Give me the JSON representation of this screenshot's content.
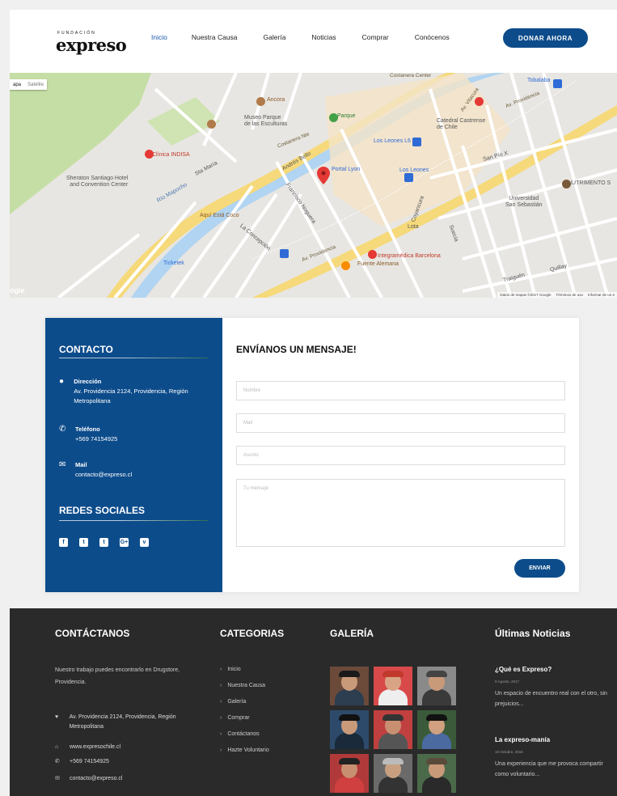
{
  "header": {
    "logo_small": "FUNDACIÓN",
    "logo_big": "expreso",
    "nav": [
      "Inicio",
      "Nuestra Causa",
      "Galería",
      "Noticias",
      "Comprar",
      "Conócenos"
    ],
    "donate_label": "DONAR AHORA"
  },
  "map": {
    "toggle": [
      "apa",
      "Satélite"
    ],
    "google": "ogle",
    "footer": [
      "Datos de mapas ©2017 Google",
      "Términos de uso",
      "Informar de un e"
    ],
    "labels": {
      "costanera_center": "Costanera Center",
      "tobalaba": "Tobalaba",
      "ancora": "Ancora",
      "parque": "Parque",
      "museo": "Museo Parque\nde las Esculturas",
      "catedral": "Catedral Castrense\nde Chile",
      "los_leones_l6": "Los Leones L6",
      "clinica": "Clínica INDISA",
      "portal_lyon": "Portal Lyon",
      "los_leones": "Los Leones",
      "sheraton": "Sheraton Santiago Hotel\nand Convention Center",
      "nutrimento": "NUTRIMENTO S",
      "universidad": "Universidad\nSan Sebastián",
      "aqui_esta_coco": "Aquí Está Coco",
      "ticketek": "Ticketek",
      "integramedica": "Integramédica Barcelona",
      "fuente_alemana": "Fuente Alemana",
      "av_providencia": "Av. Providencia",
      "costanera_nte": "Costanera Nte",
      "rio_mapocho": "Río Mapocho",
      "sta_maria": "Sta María",
      "andres_bello": "Andrés Bello",
      "av_vitacura": "Av. Vitacura",
      "san_pio_x": "San Pío X",
      "coyancura": "Coyancura",
      "lota": "Lota",
      "suecia": "Suecia",
      "traiguen": "Traiguén",
      "quillay": "Quillay",
      "la_concepcion": "La Concepción",
      "francisco_noguera": "Francisco Noguera"
    }
  },
  "contact": {
    "title": "CONTACTO",
    "items": [
      {
        "icon": "location-pin-icon",
        "label": "Dirección",
        "value": "Av. Providencia 2124, Providencia, Región Metropolitana"
      },
      {
        "icon": "phone-icon",
        "label": "Teléfono",
        "value": "+569 74154925"
      },
      {
        "icon": "mail-icon",
        "label": "Mail",
        "value": "contacto@expreso.cl"
      }
    ],
    "social_title": "REDES SOCIALES",
    "social": [
      "f",
      "t",
      "t",
      "G+",
      "v"
    ]
  },
  "form": {
    "title": "ENVÍANOS UN MENSAJE!",
    "name_placeholder": "Nombre",
    "mail_placeholder": "Mail",
    "subject_placeholder": "Asunto",
    "message_placeholder": "Tu mensaje",
    "send_label": "ENVIAR"
  },
  "footer": {
    "contact_title": "CONTÁCTANOS",
    "contact_text": "Nuestro trabajo puedes encontrarlo en Drugstore, Providencia.",
    "address": "Av. Providencia 2124, Providencia, Región Metropolitana",
    "website": "www.expresochile.cl",
    "phone": "+569 74154925",
    "email": "contacto@expreso.cl",
    "categories_title": "CATEGORIAS",
    "categories": [
      "Inicio",
      "Nuestra Causa",
      "Galería",
      "Comprar",
      "Contáctanos",
      "Hazte Voluntario"
    ],
    "gallery_title": "GALERÍA",
    "news_title": "Últimas Noticias",
    "news": [
      {
        "title": "¿Qué es Expreso?",
        "date": "9 Agosto, 2017",
        "excerpt": "Un espacio de encuentro real con el otro, sin prejuicios..."
      },
      {
        "title": "La expreso-manía",
        "date": "16 Octubre, 2016",
        "excerpt": "Una experiencia que me provoca compartir como voluntario..."
      }
    ]
  },
  "colors": {
    "brand_blue": "#0d4c8b",
    "footer_bg": "#2a2a2a",
    "nav_active": "#1a5aa8"
  }
}
